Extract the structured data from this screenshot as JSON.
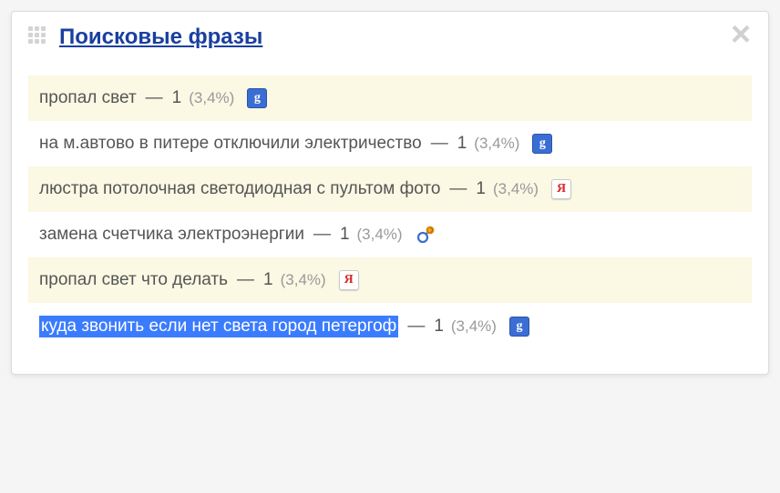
{
  "header": {
    "title": "Поисковые фразы"
  },
  "rows": [
    {
      "phrase": "пропал свет",
      "count": "1",
      "pct": "(3,4%)",
      "engine": "google",
      "alt": true,
      "highlight": false
    },
    {
      "phrase": "на м.автово в питере отключили электричество",
      "count": "1",
      "pct": "(3,4%)",
      "engine": "google",
      "alt": false,
      "highlight": false
    },
    {
      "phrase": "люстра потолочная светодиодная с пультом фото",
      "count": "1",
      "pct": "(3,4%)",
      "engine": "yandex",
      "alt": true,
      "highlight": false
    },
    {
      "phrase": "замена счетчика электроэнергии",
      "count": "1",
      "pct": "(3,4%)",
      "engine": "mail",
      "alt": false,
      "highlight": false
    },
    {
      "phrase": "пропал свет что делать",
      "count": "1",
      "pct": "(3,4%)",
      "engine": "yandex",
      "alt": true,
      "highlight": false
    },
    {
      "phrase": "куда звонить если нет света город петергоф",
      "count": "1",
      "pct": "(3,4%)",
      "engine": "google",
      "alt": false,
      "highlight": true
    }
  ],
  "icons": {
    "google_glyph": "g",
    "yandex_glyph": "Я"
  }
}
